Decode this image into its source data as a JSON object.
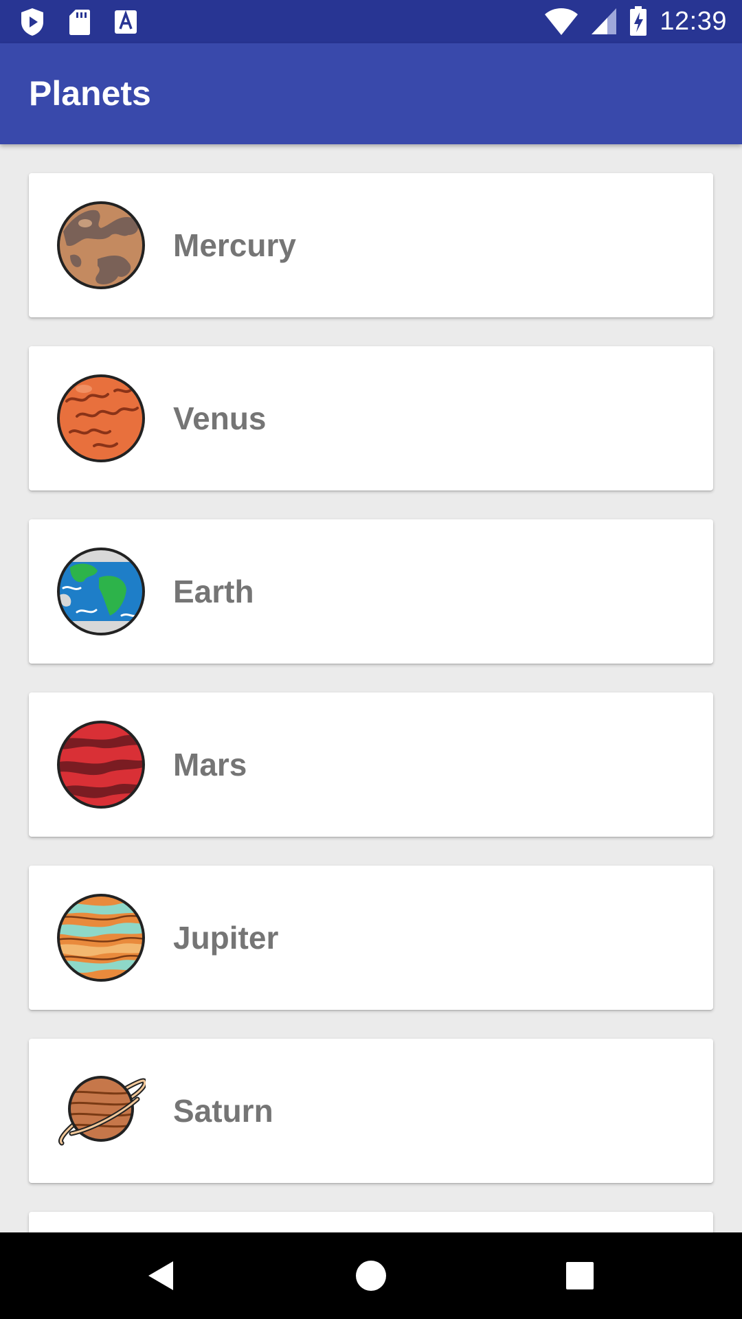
{
  "status_bar": {
    "time": "12:39",
    "left_icons": [
      "play-protect-icon",
      "sd-card-icon",
      "text-a-icon"
    ],
    "right_icons": [
      "wifi-icon",
      "cell-signal-icon",
      "battery-charging-icon"
    ]
  },
  "app_bar": {
    "title": "Planets",
    "color": "#3949AB",
    "status_color": "#283593"
  },
  "planets": [
    {
      "name": "Mercury",
      "icon": "mercury-icon"
    },
    {
      "name": "Venus",
      "icon": "venus-icon"
    },
    {
      "name": "Earth",
      "icon": "earth-icon"
    },
    {
      "name": "Mars",
      "icon": "mars-icon"
    },
    {
      "name": "Jupiter",
      "icon": "jupiter-icon"
    },
    {
      "name": "Saturn",
      "icon": "saturn-icon"
    }
  ],
  "nav_bar": {
    "buttons": [
      "back-icon",
      "home-icon",
      "recents-icon"
    ]
  }
}
